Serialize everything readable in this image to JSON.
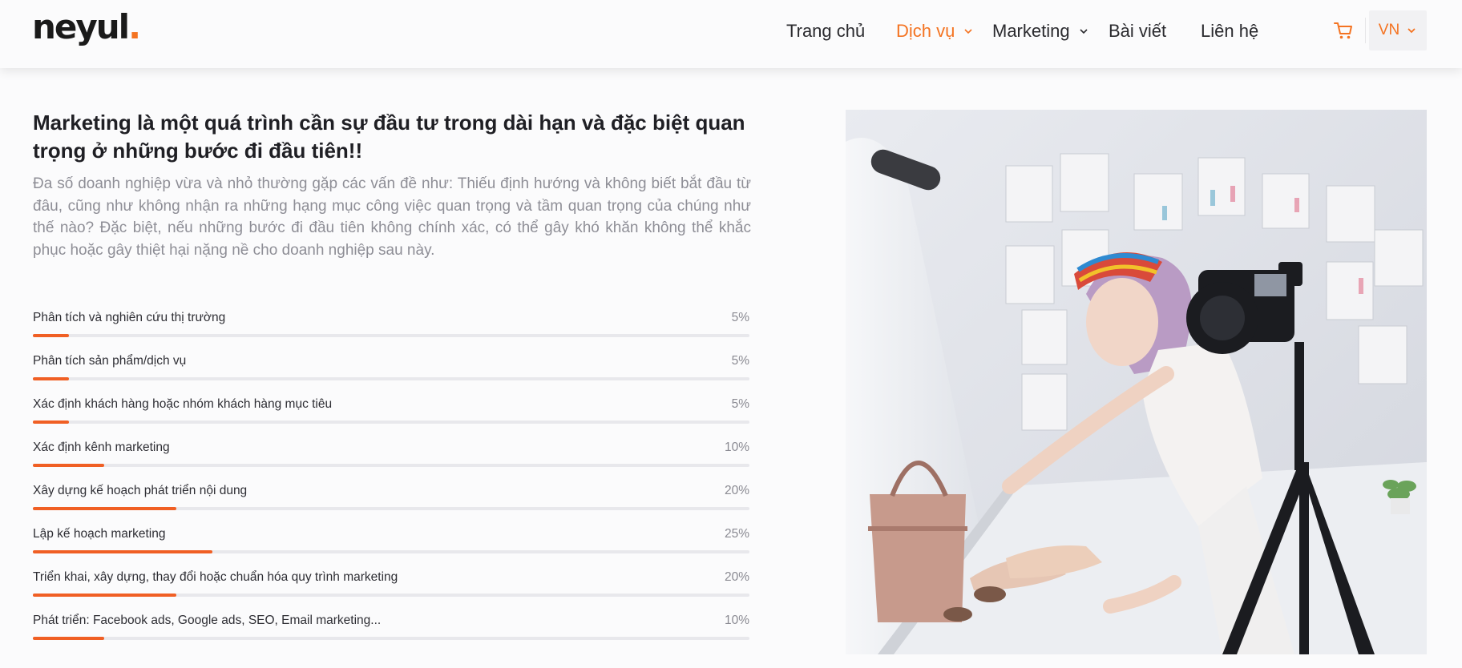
{
  "brand": {
    "logo_text": "neyul",
    "logo_dot": ".",
    "accent": "#f47321"
  },
  "nav": {
    "items": [
      {
        "label": "Trang chủ",
        "active": false,
        "dropdown": false
      },
      {
        "label": "Dịch vụ",
        "active": true,
        "dropdown": true
      },
      {
        "label": "Marketing",
        "active": false,
        "dropdown": true
      },
      {
        "label": "Bài viết",
        "active": false,
        "dropdown": false
      },
      {
        "label": "Liên hệ",
        "active": false,
        "dropdown": false
      }
    ],
    "cart_icon": "shopping-cart-icon",
    "language": "VN"
  },
  "main": {
    "headline": "Marketing là một quá trình cần sự đầu tư trong dài hạn và đặc biệt quan trọng ở những bước đi đầu tiên!!",
    "intro": "Đa số doanh nghiệp vừa và nhỏ thường gặp các vấn đề như: Thiếu định hướng và không biết bắt đầu từ đâu, cũng như không nhận ra những hạng mục công việc quan trọng và tầm quan trọng của chúng như thế nào? Đặc biệt, nếu những bước đi đầu tiên không chính xác, có thể gây khó khăn không thể khắc phục hoặc gây thiệt hại nặng nề cho doanh nghiệp sau này.",
    "skills": [
      {
        "label": "Phân tích và nghiên cứu thị trường",
        "percent": "5%",
        "value": 5
      },
      {
        "label": "Phân tích sản phẩm/dịch vụ",
        "percent": "5%",
        "value": 5
      },
      {
        "label": "Xác định khách hàng hoặc nhóm khách hàng mục tiêu",
        "percent": "5%",
        "value": 5
      },
      {
        "label": "Xác định kênh marketing",
        "percent": "10%",
        "value": 10
      },
      {
        "label": "Xây dựng kế hoạch phát triển nội dung",
        "percent": "20%",
        "value": 20
      },
      {
        "label": "Lập kế hoạch marketing",
        "percent": "25%",
        "value": 25
      },
      {
        "label": "Triển khai, xây dựng, thay đổi hoặc chuẩn hóa quy trình marketing",
        "percent": "20%",
        "value": 20
      },
      {
        "label": "Phát triển: Facebook ads, Google ads, SEO, Email marketing...",
        "percent": "10%",
        "value": 10
      }
    ],
    "bar_color": "#f05f24",
    "track_color": "#e8e8ec"
  }
}
